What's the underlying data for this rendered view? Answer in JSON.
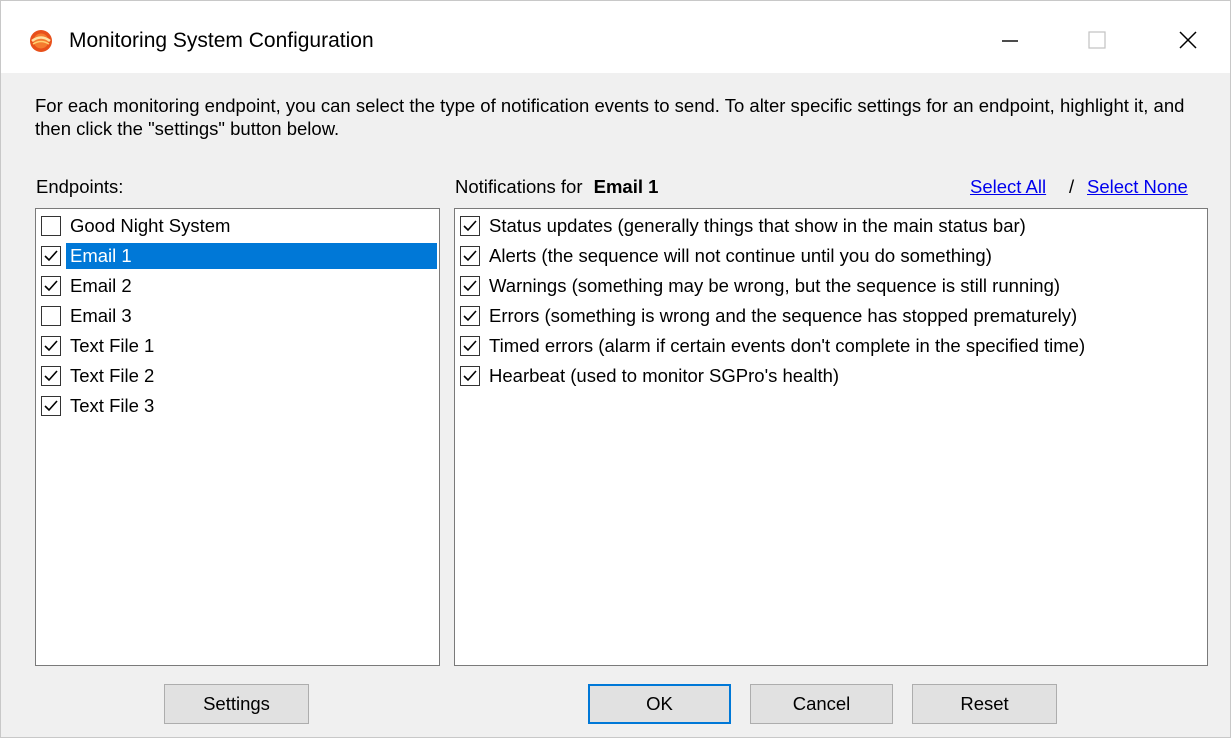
{
  "window": {
    "title": "Monitoring System Configuration"
  },
  "intro_text": "For each monitoring endpoint, you can select the type of notification events to send.  To alter specific settings for an endpoint, highlight it, and then click the \"settings\" button below.",
  "endpoints": {
    "label": "Endpoints:",
    "items": [
      {
        "label": "Good Night System",
        "checked": false,
        "selected": false
      },
      {
        "label": "Email 1",
        "checked": true,
        "selected": true
      },
      {
        "label": "Email 2",
        "checked": true,
        "selected": false
      },
      {
        "label": "Email 3",
        "checked": false,
        "selected": false
      },
      {
        "label": "Text File 1",
        "checked": true,
        "selected": false
      },
      {
        "label": "Text File 2",
        "checked": true,
        "selected": false
      },
      {
        "label": "Text File 3",
        "checked": true,
        "selected": false
      }
    ]
  },
  "notifications": {
    "label_prefix": "Notifications for",
    "endpoint_name": "Email 1",
    "select_all": "Select All",
    "separator": "/",
    "select_none": "Select None",
    "items": [
      {
        "label": "Status updates (generally things that show in the main status bar)",
        "checked": true
      },
      {
        "label": "Alerts (the sequence will not continue until you do something)",
        "checked": true
      },
      {
        "label": "Warnings (something may be wrong, but the sequence is still running)",
        "checked": true
      },
      {
        "label": "Errors (something is wrong and the sequence has stopped prematurely)",
        "checked": true
      },
      {
        "label": "Timed errors (alarm if certain events don't complete in the specified time)",
        "checked": true
      },
      {
        "label": "Hearbeat (used to monitor SGPro's health)",
        "checked": true
      }
    ]
  },
  "buttons": {
    "settings": "Settings",
    "ok": "OK",
    "cancel": "Cancel",
    "reset": "Reset"
  },
  "colors": {
    "selection": "#0078d7",
    "link": "#0000ee",
    "default_button_border": "#0078d7"
  }
}
